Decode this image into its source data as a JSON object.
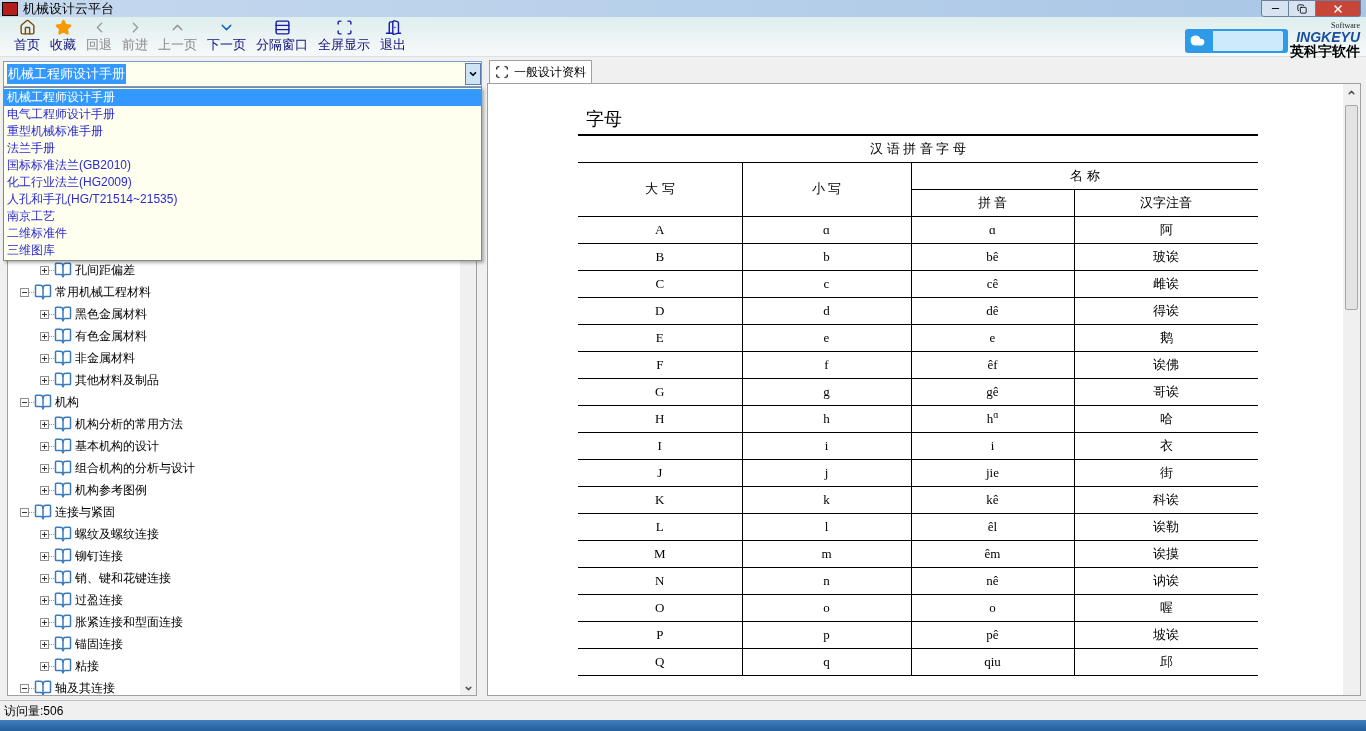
{
  "window": {
    "title": "机械设计云平台"
  },
  "toolbar": [
    {
      "label": "首页",
      "disabled": false
    },
    {
      "label": "收藏",
      "disabled": false
    },
    {
      "label": "回退",
      "disabled": true
    },
    {
      "label": "前进",
      "disabled": true
    },
    {
      "label": "上一页",
      "disabled": true
    },
    {
      "label": "下一页",
      "disabled": false
    },
    {
      "label": "分隔窗口",
      "disabled": false
    },
    {
      "label": "全屏显示",
      "disabled": false
    },
    {
      "label": "退出",
      "disabled": false
    }
  ],
  "logo": {
    "software": "Software",
    "brand": "INGKEYU",
    "name": "英科宇软件"
  },
  "combo": {
    "value": "机械工程师设计手册",
    "expanded": true,
    "options": [
      {
        "label": "机械工程师设计手册",
        "selected": true
      },
      {
        "label": "电气工程师设计手册",
        "selected": false
      },
      {
        "label": "重型机械标准手册",
        "selected": false
      },
      {
        "label": "法兰手册",
        "selected": false
      },
      {
        "label": "国标标准法兰(GB2010)",
        "selected": false
      },
      {
        "label": "化工行业法兰(HG2009)",
        "selected": false
      },
      {
        "label": "人孔和手孔(HG/T21514~21535)",
        "selected": false
      },
      {
        "label": "南京工艺",
        "selected": false
      },
      {
        "label": "二维标准件",
        "selected": false
      },
      {
        "label": "三维图库",
        "selected": false
      }
    ]
  },
  "tree": {
    "partial_children": [
      {
        "label": "孔间距偏差",
        "expanded": false
      }
    ],
    "items": [
      {
        "label": "常用机械工程材料",
        "expanded": true,
        "children": [
          {
            "label": "黑色金属材料",
            "expanded": false
          },
          {
            "label": "有色金属材料",
            "expanded": false
          },
          {
            "label": "非金属材料",
            "expanded": false
          },
          {
            "label": "其他材料及制品",
            "expanded": false
          }
        ]
      },
      {
        "label": "机构",
        "expanded": true,
        "children": [
          {
            "label": "机构分析的常用方法",
            "expanded": false
          },
          {
            "label": "基本机构的设计",
            "expanded": false
          },
          {
            "label": "组合机构的分析与设计",
            "expanded": false
          },
          {
            "label": "机构参考图例",
            "expanded": false
          }
        ]
      },
      {
        "label": "连接与紧固",
        "expanded": true,
        "children": [
          {
            "label": "螺纹及螺纹连接",
            "expanded": false
          },
          {
            "label": "铆钉连接",
            "expanded": false
          },
          {
            "label": "销、键和花键连接",
            "expanded": false
          },
          {
            "label": "过盈连接",
            "expanded": false
          },
          {
            "label": "胀紧连接和型面连接",
            "expanded": false
          },
          {
            "label": "锚固连接",
            "expanded": false
          },
          {
            "label": "粘接",
            "expanded": false
          }
        ]
      },
      {
        "label": "轴及其连接",
        "expanded": true
      }
    ]
  },
  "tabs": [
    {
      "label": "一般设计资料",
      "selected": true
    }
  ],
  "document": {
    "heading": "字母",
    "table_title": "汉 语 拼 音 字 母",
    "columns": {
      "upper": "大 写",
      "lower": "小 写",
      "name": "名 称",
      "pinyin": "拼 音",
      "hanzi": "汉字注音"
    },
    "rows": [
      [
        "A",
        "ɑ",
        "ɑ",
        "阿"
      ],
      [
        "B",
        "b",
        "bê",
        "玻诶"
      ],
      [
        "C",
        "c",
        "cê",
        "雌诶"
      ],
      [
        "D",
        "d",
        "dê",
        "得诶"
      ],
      [
        "E",
        "e",
        "e",
        "鹅"
      ],
      [
        "F",
        "f",
        "êf",
        "诶佛"
      ],
      [
        "G",
        "g",
        "gê",
        "哥诶"
      ],
      [
        "H",
        "h",
        "h$^{ɑ}$",
        "哈"
      ],
      [
        "I",
        "i",
        "i",
        "衣"
      ],
      [
        "J",
        "j",
        "jie",
        "街"
      ],
      [
        "K",
        "k",
        "kê",
        "科诶"
      ],
      [
        "L",
        "l",
        "êl",
        "诶勒"
      ],
      [
        "M",
        "m",
        "êm",
        "诶摸"
      ],
      [
        "N",
        "n",
        "nê",
        "讷诶"
      ],
      [
        "O",
        "o",
        "o",
        "喔"
      ],
      [
        "P",
        "p",
        "pê",
        "坡诶"
      ],
      [
        "Q",
        "q",
        "qiu",
        "邱"
      ]
    ]
  },
  "status_bar": {
    "text": "访问量:506"
  }
}
